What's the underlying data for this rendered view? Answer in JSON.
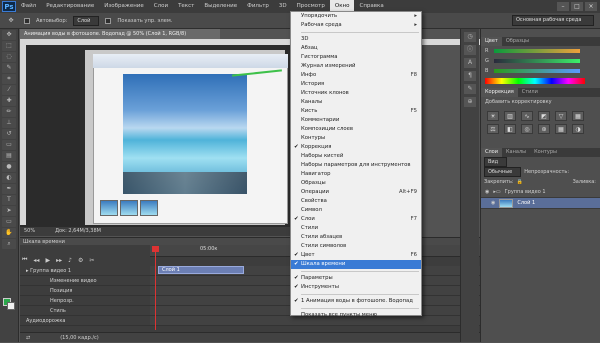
{
  "menubar": {
    "logo": "Ps",
    "items": [
      "Файл",
      "Редактирование",
      "Изображение",
      "Слои",
      "Текст",
      "Выделение",
      "Фильтр",
      "3D",
      "Просмотр",
      "Окно",
      "Справка"
    ],
    "window_controls": [
      "–",
      "□",
      "×"
    ]
  },
  "options": {
    "autoselect_label": "Автовыбор:",
    "autoselect_value": "Слой",
    "show_controls_label": "Показать упр. элем.",
    "workspace": "Основная рабочая среда"
  },
  "document": {
    "tab_title": "Анимация воды в фотошопе. Водопад @ 50% (Слой 1, RGB/8)",
    "zoom": "50%",
    "doc_size": "Док: 2,64M/3,38M"
  },
  "timeline": {
    "tab": "Шкала времени",
    "time_label": "05:00к",
    "rows": [
      {
        "label": "Группа видео 1",
        "icon": "▸"
      },
      {
        "label": "Изменение видео",
        "icon": ""
      },
      {
        "label": "Позиция",
        "icon": ""
      },
      {
        "label": "Непрозр.",
        "icon": ""
      },
      {
        "label": "Стиль",
        "icon": ""
      }
    ],
    "layer_clip": "Слой 1",
    "audio_label": "Аудиодорожка",
    "fps_label": "(15,00 кадр./с)"
  },
  "panels": {
    "color_tabs": [
      "Цвет",
      "Образцы"
    ],
    "adjust_tabs": [
      "Коррекция",
      "Стили"
    ],
    "adjust_title": "Добавить корректировку",
    "layers_tabs": [
      "Слои",
      "Каналы",
      "Контуры"
    ],
    "layers_kind": "Вид",
    "blend_mode": "Обычные",
    "opacity_label": "Непрозрачность:",
    "lock_label": "Закрепить:",
    "fill_label": "Заливка:",
    "layer_items": [
      {
        "name": "Группа видео 1",
        "selected": false
      },
      {
        "name": "Слой 1",
        "selected": true
      }
    ]
  },
  "window_menu": {
    "items": [
      {
        "label": "Упорядочить",
        "shortcut": "▸",
        "checked": false,
        "sep_after": false
      },
      {
        "label": "Рабочая среда",
        "shortcut": "▸",
        "checked": false,
        "sep_after": true
      },
      {
        "label": "3D",
        "shortcut": "",
        "checked": false,
        "sep_after": false
      },
      {
        "label": "Абзац",
        "shortcut": "",
        "checked": false,
        "sep_after": false
      },
      {
        "label": "Гистограмма",
        "shortcut": "",
        "checked": false,
        "sep_after": false
      },
      {
        "label": "Журнал измерений",
        "shortcut": "",
        "checked": false,
        "sep_after": false
      },
      {
        "label": "Инфо",
        "shortcut": "F8",
        "checked": false,
        "sep_after": false
      },
      {
        "label": "История",
        "shortcut": "",
        "checked": false,
        "sep_after": false
      },
      {
        "label": "Источник клонов",
        "shortcut": "",
        "checked": false,
        "sep_after": false
      },
      {
        "label": "Каналы",
        "shortcut": "",
        "checked": false,
        "sep_after": false
      },
      {
        "label": "Кисть",
        "shortcut": "F5",
        "checked": false,
        "sep_after": false
      },
      {
        "label": "Комментарии",
        "shortcut": "",
        "checked": false,
        "sep_after": false
      },
      {
        "label": "Композиции слоев",
        "shortcut": "",
        "checked": false,
        "sep_after": false
      },
      {
        "label": "Контуры",
        "shortcut": "",
        "checked": false,
        "sep_after": false
      },
      {
        "label": "Коррекция",
        "shortcut": "",
        "checked": true,
        "sep_after": false
      },
      {
        "label": "Наборы кистей",
        "shortcut": "",
        "checked": false,
        "sep_after": false
      },
      {
        "label": "Наборы параметров для инструментов",
        "shortcut": "",
        "checked": false,
        "sep_after": false
      },
      {
        "label": "Навигатор",
        "shortcut": "",
        "checked": false,
        "sep_after": false
      },
      {
        "label": "Образцы",
        "shortcut": "",
        "checked": false,
        "sep_after": false
      },
      {
        "label": "Операции",
        "shortcut": "Alt+F9",
        "checked": false,
        "sep_after": false
      },
      {
        "label": "Свойства",
        "shortcut": "",
        "checked": false,
        "sep_after": false
      },
      {
        "label": "Символ",
        "shortcut": "",
        "checked": false,
        "sep_after": false
      },
      {
        "label": "Слои",
        "shortcut": "F7",
        "checked": true,
        "sep_after": false
      },
      {
        "label": "Стили",
        "shortcut": "",
        "checked": false,
        "sep_after": false
      },
      {
        "label": "Стили абзацев",
        "shortcut": "",
        "checked": false,
        "sep_after": false
      },
      {
        "label": "Стили символов",
        "shortcut": "",
        "checked": false,
        "sep_after": false
      },
      {
        "label": "Цвет",
        "shortcut": "F6",
        "checked": true,
        "sep_after": false
      },
      {
        "label": "Шкала времени",
        "shortcut": "",
        "checked": true,
        "highlight": true,
        "sep_after": true
      },
      {
        "label": "Параметры",
        "shortcut": "",
        "checked": true,
        "sep_after": false
      },
      {
        "label": "Инструменты",
        "shortcut": "",
        "checked": true,
        "sep_after": true
      },
      {
        "label": "1 Анимация воды в фотошопе. Водопад",
        "shortcut": "",
        "checked": true,
        "sep_after": true
      },
      {
        "label": "Показать все пункты меню",
        "shortcut": "",
        "checked": false,
        "sep_after": false
      }
    ]
  },
  "colors": {
    "foreground": "#2aa84a",
    "background": "#f0f0f0",
    "menu_highlight": "#3a7bd5"
  }
}
